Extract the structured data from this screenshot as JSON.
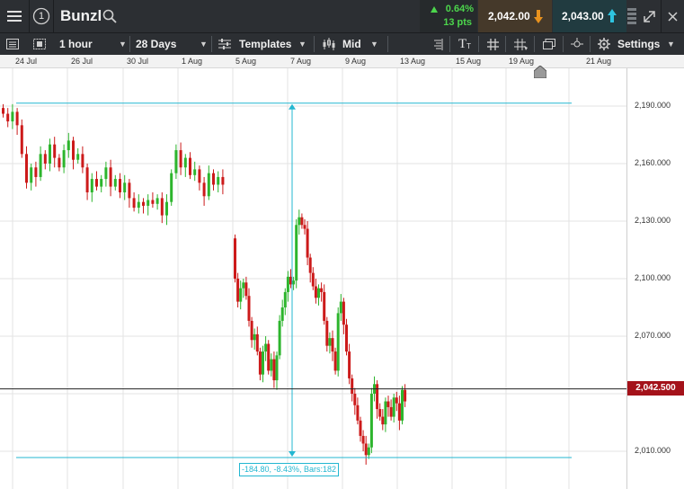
{
  "header": {
    "menu_icon": "hamburger-icon",
    "info_number": "1",
    "instrument": "Bunzl",
    "change_pct": "0.64%",
    "change_pts": "13 pts",
    "sell_price": "2,042.00",
    "buy_price": "2,043.00"
  },
  "toolbar": {
    "interval": "1 hour",
    "period": "28 Days",
    "templates": "Templates",
    "price_type": "Mid",
    "text_tool": "T",
    "settings": "Settings"
  },
  "date_axis": [
    "24 Jul",
    "26 Jul",
    "30 Jul",
    "1 Aug",
    "5 Aug",
    "7 Aug",
    "9 Aug",
    "13 Aug",
    "15 Aug",
    "19 Aug",
    "21 Aug"
  ],
  "price_axis": [
    "2,190.000",
    "2,160.000",
    "2,130.000",
    "2,100.000",
    "2,070.000",
    "2,042.500",
    "2,010.000"
  ],
  "current_price": "2,042.500",
  "measure_label": "-184.80, -8.43%, Bars:182",
  "colors": {
    "up": "#2db52d",
    "down": "#cc1a1a",
    "measure": "#23b7d1",
    "price_tag": "#a4121a"
  },
  "chart_data": {
    "type": "candlestick",
    "ylim": [
      2005,
      2205
    ],
    "grid": true,
    "price_line": 2042.5,
    "measure": {
      "from_price": 2191.5,
      "to_price": 2006.7,
      "change": -184.8,
      "change_pct": -8.43,
      "bars": 182
    },
    "series": [
      {
        "values": [
          [
            2189,
            2186
          ],
          [
            2186,
            2182
          ],
          [
            2182,
            2187
          ],
          [
            2187,
            2180
          ],
          [
            2180,
            2165
          ],
          [
            2165,
            2150
          ],
          [
            2150,
            2158
          ],
          [
            2158,
            2153
          ],
          [
            2153,
            2165
          ],
          [
            2165,
            2160
          ],
          [
            2160,
            2170
          ],
          [
            2170,
            2163
          ],
          [
            2163,
            2158
          ],
          [
            2158,
            2167
          ],
          [
            2167,
            2172
          ],
          [
            2172,
            2162
          ],
          [
            2162,
            2165
          ],
          [
            2165,
            2158
          ],
          [
            2158,
            2145
          ],
          [
            2145,
            2152
          ],
          [
            2152,
            2148
          ],
          [
            2148,
            2152
          ],
          [
            2152,
            2158
          ],
          [
            2158,
            2148
          ],
          [
            2148,
            2152
          ],
          [
            2152,
            2145
          ],
          [
            2145,
            2150
          ],
          [
            2150,
            2142
          ],
          [
            2142,
            2137
          ],
          [
            2137,
            2140
          ],
          [
            2140,
            2138
          ],
          [
            2138,
            2141
          ],
          [
            2141,
            2139
          ],
          [
            2139,
            2142
          ],
          [
            2142,
            2133
          ],
          [
            2133,
            2140
          ],
          [
            2140,
            2155
          ],
          [
            2155,
            2167
          ],
          [
            2167,
            2158
          ],
          [
            2158,
            2163
          ],
          [
            2163,
            2154
          ],
          [
            2154,
            2157
          ],
          [
            2157,
            2150
          ],
          [
            2150,
            2143
          ],
          [
            2143,
            2155
          ],
          [
            2155,
            2149
          ],
          [
            2149,
            2153
          ],
          [
            2153,
            2149
          ],
          [
            2121,
            2100
          ],
          [
            2100,
            2088
          ],
          [
            2088,
            2095
          ],
          [
            2095,
            2098
          ],
          [
            2098,
            2091
          ],
          [
            2091,
            2078
          ],
          [
            2078,
            2068
          ],
          [
            2068,
            2071
          ],
          [
            2071,
            2062
          ],
          [
            2062,
            2050
          ],
          [
            2050,
            2062
          ],
          [
            2062,
            2066
          ],
          [
            2066,
            2052
          ],
          [
            2052,
            2058
          ],
          [
            2058,
            2047
          ],
          [
            2047,
            2060
          ],
          [
            2060,
            2078
          ],
          [
            2078,
            2085
          ],
          [
            2085,
            2093
          ],
          [
            2093,
            2101
          ],
          [
            2101,
            2097
          ],
          [
            2097,
            2099
          ],
          [
            2099,
            2128
          ],
          [
            2128,
            2132
          ],
          [
            2132,
            2128
          ],
          [
            2128,
            2126
          ],
          [
            2126,
            2111
          ],
          [
            2111,
            2103
          ],
          [
            2103,
            2096
          ],
          [
            2096,
            2090
          ],
          [
            2090,
            2095
          ],
          [
            2095,
            2093
          ],
          [
            2093,
            2078
          ],
          [
            2078,
            2065
          ],
          [
            2065,
            2069
          ],
          [
            2069,
            2062
          ],
          [
            2062,
            2052
          ],
          [
            2052,
            2082
          ],
          [
            2082,
            2088
          ],
          [
            2088,
            2076
          ],
          [
            2076,
            2062
          ],
          [
            2062,
            2048
          ],
          [
            2048,
            2040
          ],
          [
            2040,
            2034
          ],
          [
            2034,
            2026
          ],
          [
            2026,
            2018
          ],
          [
            2018,
            2014
          ],
          [
            2014,
            2008
          ],
          [
            2008,
            2012
          ],
          [
            2012,
            2040
          ],
          [
            2040,
            2045
          ],
          [
            2045,
            2032
          ],
          [
            2032,
            2028
          ],
          [
            2028,
            2024
          ],
          [
            2024,
            2036
          ],
          [
            2036,
            2033
          ],
          [
            2033,
            2028
          ],
          [
            2028,
            2038
          ],
          [
            2038,
            2035
          ],
          [
            2035,
            2026
          ],
          [
            2026,
            2042
          ],
          [
            2042,
            2036
          ]
        ]
      }
    ]
  }
}
